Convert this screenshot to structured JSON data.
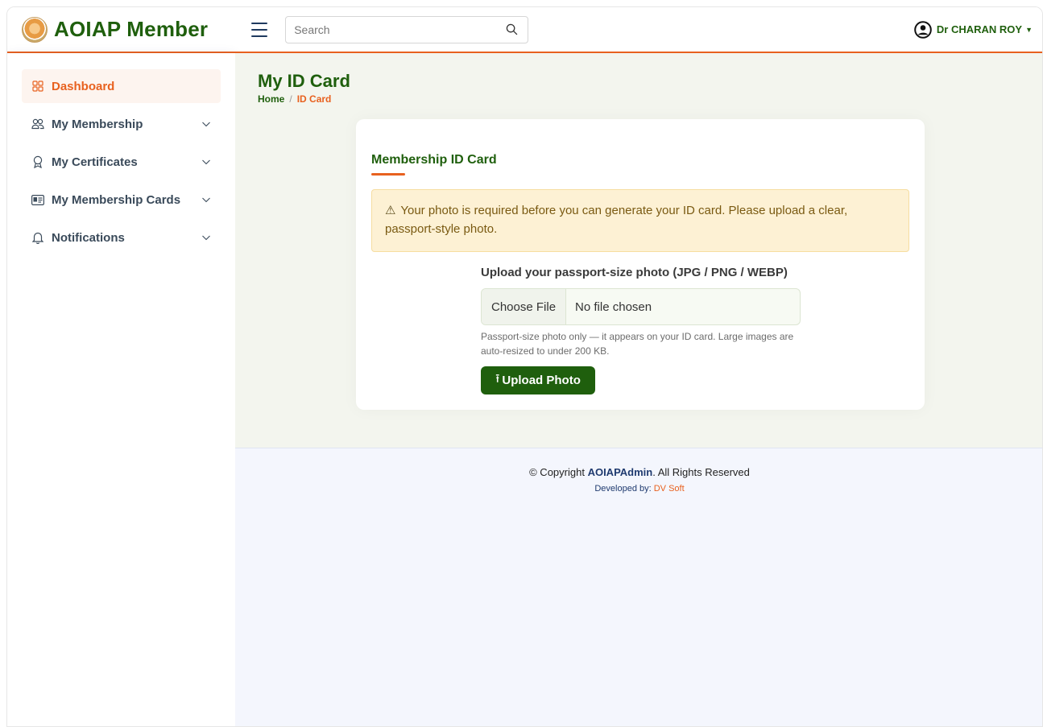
{
  "header": {
    "logo_text": "AOIAP Member",
    "search_placeholder": "Search",
    "user_name": "Dr CHARAN ROY"
  },
  "sidebar": {
    "items": [
      {
        "label": "Dashboard",
        "icon": "grid-icon",
        "active": true
      },
      {
        "label": "My Membership",
        "icon": "people-icon"
      },
      {
        "label": "My Certificates",
        "icon": "award-icon"
      },
      {
        "label": "My Membership Cards",
        "icon": "id-card-icon"
      },
      {
        "label": "Notifications",
        "icon": "bell-icon"
      }
    ]
  },
  "page": {
    "title": "My ID Card",
    "breadcrumb_home": "Home",
    "breadcrumb_sep": "/",
    "breadcrumb_current": "ID Card"
  },
  "card": {
    "title": "Membership ID Card",
    "alert_icon": "⚠",
    "alert_text": "Your photo is required before you can generate your ID card. Please upload a clear, passport-style photo.",
    "upload_label": "Upload your passport-size photo (JPG / PNG / WEBP)",
    "file_button": "Choose File",
    "file_status": "No file chosen",
    "help_text": "Passport-size photo only — it appears on your ID card. Large images are auto-resized to under 200 KB.",
    "upload_button_icon": "⭱",
    "upload_button": "Upload Photo"
  },
  "footer": {
    "copyright_prefix": "© Copyright",
    "copyright_brand": "AOIAPAdmin",
    "copyright_suffix": ". All Rights Reserved",
    "developed_by": "Developed by:",
    "developer": "DV Soft"
  },
  "colors": {
    "brand_green": "#1f5f0d",
    "accent_orange": "#e8611f",
    "alert_bg": "#fdf1d4"
  }
}
